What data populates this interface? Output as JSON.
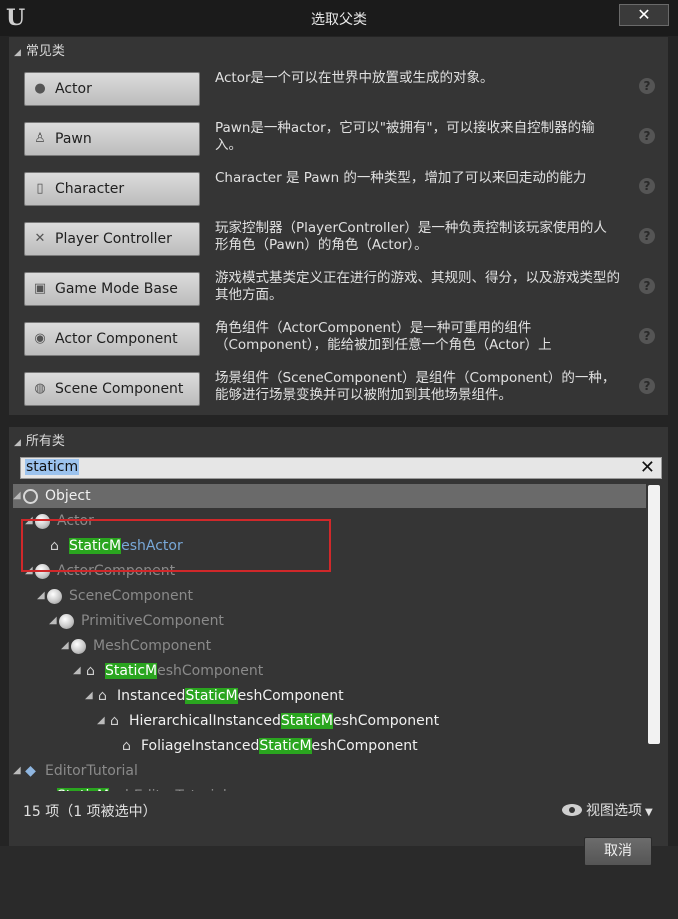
{
  "window": {
    "logo": "U",
    "title": "选取父类",
    "close_label": "✕"
  },
  "common": {
    "header": "常见类",
    "items": [
      {
        "label": "Actor",
        "icon": "actor-sphere-icon",
        "desc": "Actor是一个可以在世界中放置或生成的对象。"
      },
      {
        "label": "Pawn",
        "icon": "pawn-icon",
        "desc": "Pawn是一种actor，它可以\"被拥有\"，可以接收来自控制器的输入。"
      },
      {
        "label": "Character",
        "icon": "character-icon",
        "desc": "Character 是 Pawn 的一种类型，增加了可以来回走动的能力"
      },
      {
        "label": "Player Controller",
        "icon": "player-controller-icon",
        "desc": "玩家控制器（PlayerController）是一种负责控制该玩家使用的人形角色（Pawn）的角色（Actor）。"
      },
      {
        "label": "Game Mode Base",
        "icon": "game-mode-icon",
        "desc": "游戏模式基类定义正在进行的游戏、其规则、得分，以及游戏类型的其他方面。"
      },
      {
        "label": "Actor Component",
        "icon": "actor-component-icon",
        "desc": "角色组件（ActorComponent）是一种可重用的组件（Component），能给被加到任意一个角色（Actor）上"
      },
      {
        "label": "Scene Component",
        "icon": "scene-component-icon",
        "desc": "场景组件（SceneComponent）是组件（Component）的一种，能够进行场景变换并可以被附加到其他场景组件。"
      }
    ],
    "help_glyph": "?"
  },
  "all": {
    "header": "所有类",
    "search_value": "staticm",
    "clear_glyph": "✕",
    "tree": [
      {
        "pre": "",
        "hl": "",
        "post": "Object",
        "color": "white",
        "level": 0,
        "arrow": "◢",
        "icon": "circle",
        "selected": true
      },
      {
        "pre": "",
        "hl": "",
        "post": "Actor",
        "color": "dim",
        "level": 1,
        "arrow": "◢",
        "icon": "ball",
        "selected": false
      },
      {
        "pre": "",
        "hl": "StaticM",
        "post": "eshActor",
        "color": "blue",
        "level": 2,
        "arrow": "",
        "icon": "house",
        "selected": false
      },
      {
        "pre": "",
        "hl": "",
        "post": "ActorComponent",
        "color": "dim",
        "level": 1,
        "arrow": "◢",
        "icon": "ball",
        "selected": false
      },
      {
        "pre": "",
        "hl": "",
        "post": "SceneComponent",
        "color": "dim",
        "level": 2,
        "arrow": "◢",
        "icon": "ball",
        "selected": false
      },
      {
        "pre": "",
        "hl": "",
        "post": "PrimitiveComponent",
        "color": "dim",
        "level": 3,
        "arrow": "◢",
        "icon": "ball",
        "selected": false
      },
      {
        "pre": "",
        "hl": "",
        "post": "MeshComponent",
        "color": "dim",
        "level": 4,
        "arrow": "◢",
        "icon": "ball",
        "selected": false
      },
      {
        "pre": "",
        "hl": "StaticM",
        "post": "eshComponent",
        "color": "dim",
        "level": 5,
        "arrow": "◢",
        "icon": "house",
        "selected": false
      },
      {
        "pre": "Instanced",
        "hl": "StaticM",
        "post": "eshComponent",
        "color": "white",
        "level": 6,
        "arrow": "◢",
        "icon": "house",
        "selected": false
      },
      {
        "pre": "HierarchicalInstanced",
        "hl": "StaticM",
        "post": "eshComponent",
        "color": "white",
        "level": 7,
        "arrow": "◢",
        "icon": "house",
        "selected": false
      },
      {
        "pre": "FoliageInstanced",
        "hl": "StaticM",
        "post": "eshComponent",
        "color": "white",
        "level": 8,
        "arrow": "",
        "icon": "house",
        "selected": false
      },
      {
        "pre": "",
        "hl": "",
        "post": "EditorTutorial",
        "color": "dim",
        "level": 0,
        "arrow": "◢",
        "icon": "cube",
        "selected": false
      },
      {
        "pre": "",
        "hl": "StaticM",
        "post": "eshEditorTutorial",
        "color": "dim",
        "level": 1,
        "arrow": "",
        "icon": "cube",
        "selected": false
      }
    ],
    "status": "15 项（1 项被选中）",
    "view_options": "视图选项"
  },
  "footer": {
    "cancel_label": "取消"
  }
}
